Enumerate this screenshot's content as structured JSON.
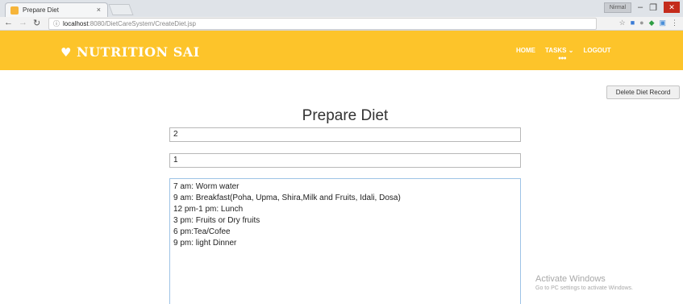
{
  "browser": {
    "tab_title": "Prepare Diet",
    "tab_close": "×",
    "window_user": "Nirmal",
    "url_host": "localhost",
    "url_path": ":8080/DietCareSystem/CreateDiet.jsp"
  },
  "navbar": {
    "brand": "NUTRITION SAI",
    "menu": {
      "home": "HOME",
      "tasks": "TASKS ⌄",
      "logout": "LOGOUT"
    }
  },
  "page": {
    "title": "Prepare Diet",
    "delete_button": "Delete Diet Record",
    "field1_value": "2",
    "field2_value": "1",
    "diet_text": "7 am: Worm water\n9 am: Breakfast(Poha, Upma, Shira,Milk and Fruits, Idali, Dosa)\n12 pm-1 pm: Lunch\n3 pm: Fruits or Dry fruits\n6 pm:Tea/Cofee\n9 pm: light Dinner"
  },
  "watermark": {
    "title": "Activate Windows",
    "subtitle": "Go to PC settings to activate Windows."
  },
  "colors": {
    "navbar": "#fdc42a",
    "text": "#222222"
  }
}
